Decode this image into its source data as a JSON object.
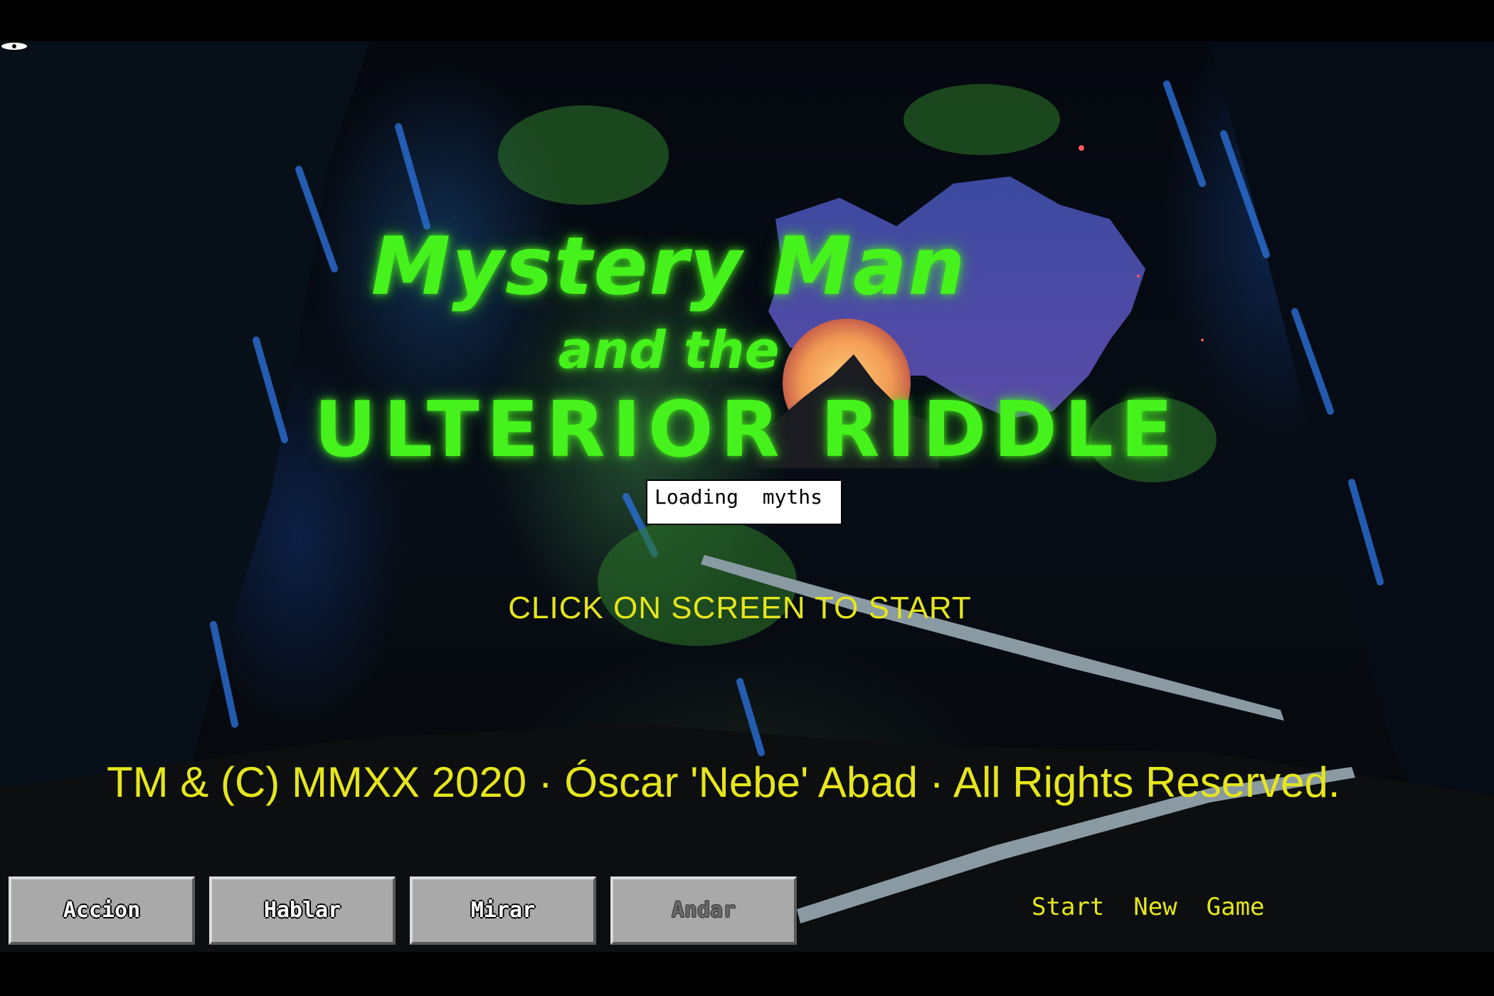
{
  "game": {
    "title_line1": "Mystery Man",
    "title_line2": "and the",
    "title_line3": "ULTERIOR RIDDLE"
  },
  "loading": {
    "text": "Loading  myths"
  },
  "prompt": {
    "click_to_start": "CLICK ON SCREEN TO START"
  },
  "copyright": {
    "text": "TM & (C) MMXX 2020 · Óscar 'Nebe' Abad · All Rights Reserved."
  },
  "verbs": {
    "items": [
      {
        "label": "Accion",
        "enabled": true
      },
      {
        "label": "Hablar",
        "enabled": true
      },
      {
        "label": "Mirar",
        "enabled": true
      },
      {
        "label": "Andar",
        "enabled": false
      }
    ]
  },
  "menu": {
    "start_new_game": "Start  New  Game"
  },
  "colors": {
    "title_green": "#46f21c",
    "text_yellow": "#e6e61c",
    "button_gray": "#a9a9a9",
    "background": "#000000"
  },
  "icons": {
    "eye_marker": "eye-icon"
  }
}
